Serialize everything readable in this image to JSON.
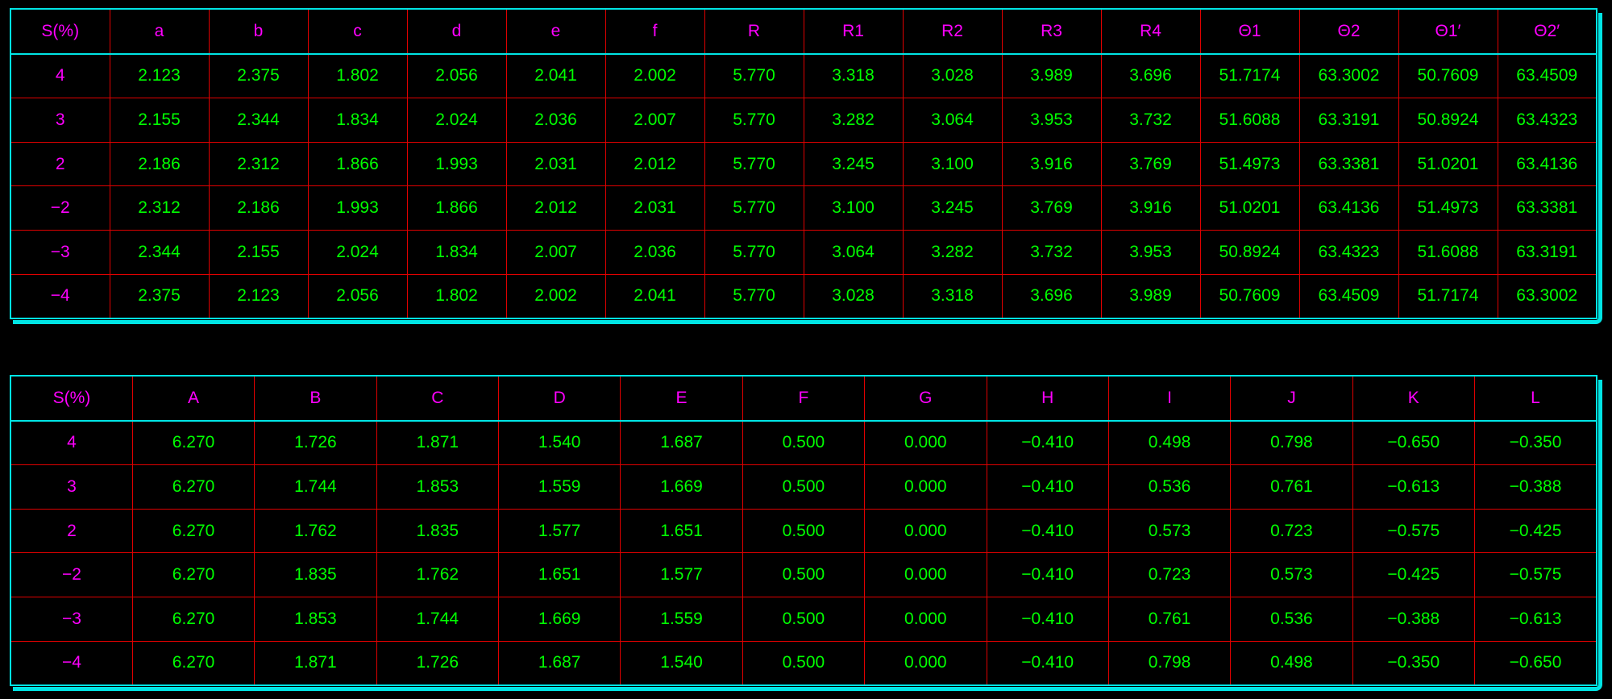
{
  "table_top": {
    "headers": [
      "S(%)",
      "a",
      "b",
      "c",
      "d",
      "e",
      "f",
      "R",
      "R1",
      "R2",
      "R3",
      "R4",
      "Θ1",
      "Θ2",
      "Θ1′",
      "Θ2′"
    ],
    "rows": [
      [
        "4",
        "2.123",
        "2.375",
        "1.802",
        "2.056",
        "2.041",
        "2.002",
        "5.770",
        "3.318",
        "3.028",
        "3.989",
        "3.696",
        "51.7174",
        "63.3002",
        "50.7609",
        "63.4509"
      ],
      [
        "3",
        "2.155",
        "2.344",
        "1.834",
        "2.024",
        "2.036",
        "2.007",
        "5.770",
        "3.282",
        "3.064",
        "3.953",
        "3.732",
        "51.6088",
        "63.3191",
        "50.8924",
        "63.4323"
      ],
      [
        "2",
        "2.186",
        "2.312",
        "1.866",
        "1.993",
        "2.031",
        "2.012",
        "5.770",
        "3.245",
        "3.100",
        "3.916",
        "3.769",
        "51.4973",
        "63.3381",
        "51.0201",
        "63.4136"
      ],
      [
        "−2",
        "2.312",
        "2.186",
        "1.993",
        "1.866",
        "2.012",
        "2.031",
        "5.770",
        "3.100",
        "3.245",
        "3.769",
        "3.916",
        "51.0201",
        "63.4136",
        "51.4973",
        "63.3381"
      ],
      [
        "−3",
        "2.344",
        "2.155",
        "2.024",
        "1.834",
        "2.007",
        "2.036",
        "5.770",
        "3.064",
        "3.282",
        "3.732",
        "3.953",
        "50.8924",
        "63.4323",
        "51.6088",
        "63.3191"
      ],
      [
        "−4",
        "2.375",
        "2.123",
        "2.056",
        "1.802",
        "2.002",
        "2.041",
        "5.770",
        "3.028",
        "3.318",
        "3.696",
        "3.989",
        "50.7609",
        "63.4509",
        "51.7174",
        "63.3002"
      ]
    ]
  },
  "table_bottom": {
    "headers": [
      "S(%)",
      "A",
      "B",
      "C",
      "D",
      "E",
      "F",
      "G",
      "H",
      "I",
      "J",
      "K",
      "L"
    ],
    "rows": [
      [
        "4",
        "6.270",
        "1.726",
        "1.871",
        "1.540",
        "1.687",
        "0.500",
        "0.000",
        "−0.410",
        "0.498",
        "0.798",
        "−0.650",
        "−0.350"
      ],
      [
        "3",
        "6.270",
        "1.744",
        "1.853",
        "1.559",
        "1.669",
        "0.500",
        "0.000",
        "−0.410",
        "0.536",
        "0.761",
        "−0.613",
        "−0.388"
      ],
      [
        "2",
        "6.270",
        "1.762",
        "1.835",
        "1.577",
        "1.651",
        "0.500",
        "0.000",
        "−0.410",
        "0.573",
        "0.723",
        "−0.575",
        "−0.425"
      ],
      [
        "−2",
        "6.270",
        "1.835",
        "1.762",
        "1.651",
        "1.577",
        "0.500",
        "0.000",
        "−0.410",
        "0.723",
        "0.573",
        "−0.425",
        "−0.575"
      ],
      [
        "−3",
        "6.270",
        "1.853",
        "1.744",
        "1.669",
        "1.559",
        "0.500",
        "0.000",
        "−0.410",
        "0.761",
        "0.536",
        "−0.388",
        "−0.613"
      ],
      [
        "−4",
        "6.270",
        "1.871",
        "1.726",
        "1.687",
        "1.540",
        "0.500",
        "0.000",
        "−0.410",
        "0.798",
        "0.498",
        "−0.350",
        "−0.650"
      ]
    ]
  },
  "colors": {
    "background": "#000000",
    "header_text": "#ff00ff",
    "value_text": "#00ff00",
    "grid_line": "#e00000",
    "frame": "#00e5e5"
  }
}
